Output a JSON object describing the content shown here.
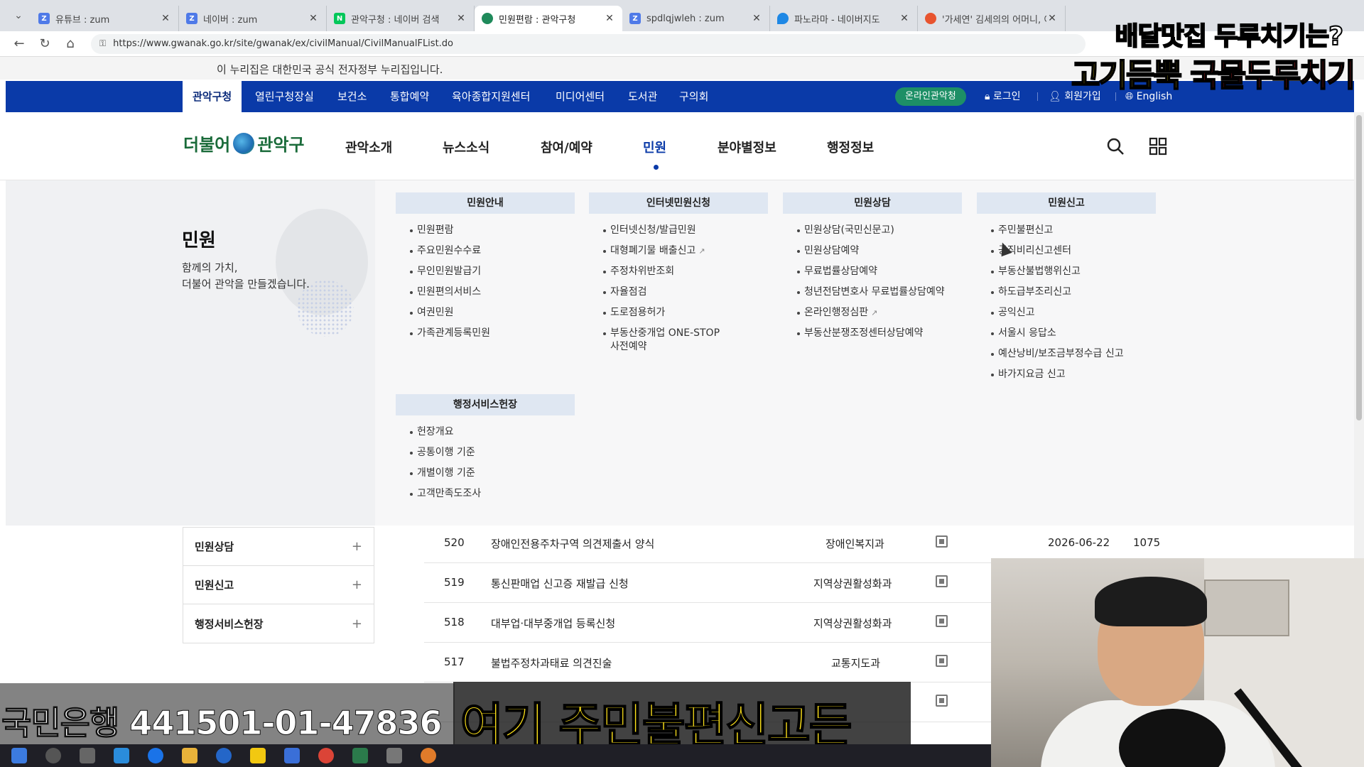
{
  "browser": {
    "tabs": [
      {
        "title": "유튜브 : zum",
        "icon": "zum-icon",
        "color": "#4f7ae8"
      },
      {
        "title": "네이버 : zum",
        "icon": "zum-icon",
        "color": "#4f7ae8"
      },
      {
        "title": "관악구청 : 네이버 검색",
        "icon": "naver-icon",
        "color": "#03c75a"
      },
      {
        "title": "민원편람 : 관악구청",
        "icon": "gwanak-icon",
        "color": "#1f8a5b",
        "active": true
      },
      {
        "title": "spdlqjwleh : zum",
        "icon": "zum-icon",
        "color": "#4f7ae8"
      },
      {
        "title": "파노라마 - 네이버지도",
        "icon": "map-pin-icon",
        "color": "#1e88e5"
      },
      {
        "title": "'가세연' 김세의의 어머니, 이",
        "icon": "news-icon",
        "color": "#e8542f"
      }
    ],
    "url": "https://www.gwanak.go.kr/site/gwanak/ex/civilManual/CivilManualFList.do"
  },
  "gov_notice": "이 누리집은 대한민국 공식 전자정부 누리집입니다.",
  "topnav": {
    "items": [
      "관악구청",
      "열린구청장실",
      "보건소",
      "통합예약",
      "육아종합지원센터",
      "미디어센터",
      "도서관",
      "구의회"
    ],
    "online": "온라인관악청",
    "login": "로그인",
    "signup": "회원가입",
    "lang": "English"
  },
  "header": {
    "logo": {
      "pre": "더불어",
      "post": "관악구"
    },
    "menu": [
      "관악소개",
      "뉴스소식",
      "참여/예약",
      "민원",
      "분야별정보",
      "행정정보"
    ]
  },
  "mega": {
    "title": "민원",
    "sub1": "함께의 가치,",
    "sub2": "더불어 관악을 만들겠습니다.",
    "columns": [
      {
        "head": "민원안내",
        "items": [
          "민원편람",
          "주요민원수수료",
          "무인민원발급기",
          "민원편의서비스",
          "여권민원",
          "가족관계등록민원"
        ]
      },
      {
        "head": "인터넷민원신청",
        "items": [
          "인터넷신청/발급민원",
          "대형폐기물 배출신고",
          "주정차위반조회",
          "자율점검",
          "도로점용허가",
          "부동산중개업 ONE-STOP",
          "사전예약"
        ]
      },
      {
        "head": "민원상담",
        "items": [
          "민원상담(국민신문고)",
          "민원상담예약",
          "무료법률상담예약",
          "청년전담변호사 무료법률상담예약",
          "온라인행정심판",
          "부동산분쟁조정센터상담예약"
        ]
      },
      {
        "head": "민원신고",
        "items": [
          "주민불편신고",
          "공직비리신고센터",
          "부동산불법행위신고",
          "하도급부조리신고",
          "공익신고",
          "서울시 응답소",
          "예산낭비/보조금부정수급 신고",
          "바가지요금 신고"
        ]
      },
      {
        "head": "행정서비스헌장",
        "items": [
          "헌장개요",
          "공통이행 기준",
          "개별이행 기준",
          "고객만족도조사"
        ]
      }
    ]
  },
  "sidebar": [
    "민원상담",
    "민원신고",
    "행정서비스헌장"
  ],
  "table": [
    {
      "no": "520",
      "title": "장애인전용주차구역 의견제출서 양식",
      "dept": "장애인복지과",
      "date": "2026-06-22",
      "views": "1075"
    },
    {
      "no": "519",
      "title": "통신판매업 신고증 재발급 신청",
      "dept": "지역상권활성화과",
      "date": "",
      "views": ""
    },
    {
      "no": "518",
      "title": "대부업·대부중개업 등록신청",
      "dept": "지역상권활성화과",
      "date": "",
      "views": ""
    },
    {
      "no": "517",
      "title": "불법주정차과태료 의견진술",
      "dept": "교통지도과",
      "date": "",
      "views": ""
    }
  ],
  "overlay": {
    "ad_line1": "배달맛집 두루치기는?",
    "ad_line2a": "고기듬뿍 ",
    "ad_line2b": "국물두루치기",
    "bank": "국민은행 441501-01-47836",
    "caption": "여기 주민불편신고든"
  },
  "colors": {
    "primary": "#0a3aa8",
    "online": "#1d8f66",
    "caption": "#ffe31a"
  }
}
